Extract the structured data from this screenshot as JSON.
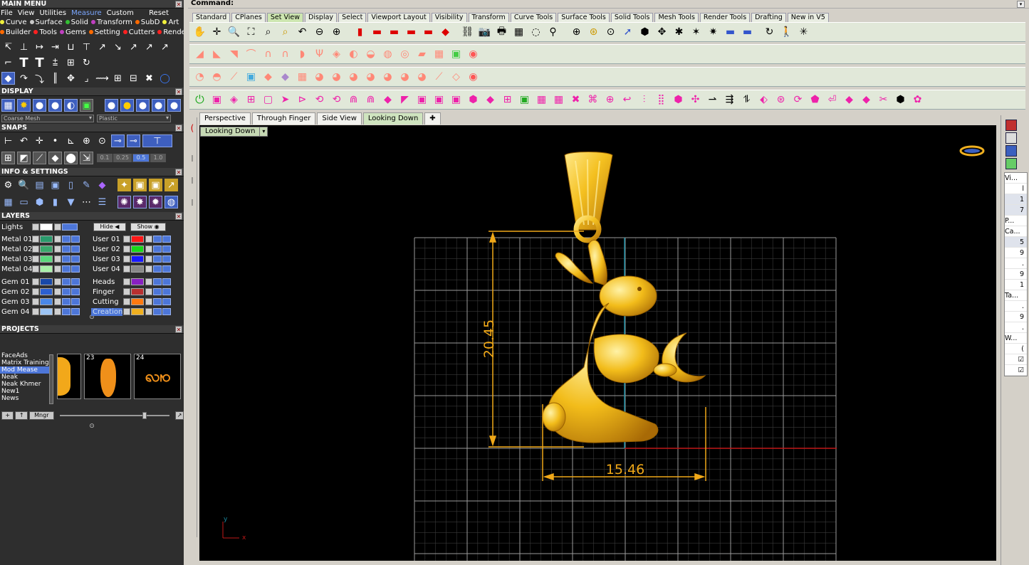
{
  "left": {
    "main_menu": {
      "title": "MAIN MENU",
      "menu": [
        "File",
        "View",
        "Utilities",
        "Measure",
        "Custom"
      ],
      "reset": "Reset",
      "row2": [
        {
          "label": "Curve",
          "color": "#f0f03c"
        },
        {
          "label": "Surface",
          "color": "#c8c8c8"
        },
        {
          "label": "Solid",
          "color": "#34c034"
        },
        {
          "label": "Transform",
          "color": "#c040c0"
        },
        {
          "label": "SubD",
          "color": "#ff6a00"
        },
        {
          "label": "Art",
          "color": "#f0f03c"
        }
      ],
      "row3": [
        {
          "label": "Builder",
          "color": "#ff6a00"
        },
        {
          "label": "Tools",
          "color": "#ff2020"
        },
        {
          "label": "Gems",
          "color": "#c040c0"
        },
        {
          "label": "Setting",
          "color": "#ff6a00"
        },
        {
          "label": "Cutters",
          "color": "#ff2020"
        },
        {
          "label": "Render",
          "color": "#ff2020"
        }
      ]
    },
    "display": {
      "title": "DISPLAY",
      "mesh_dropdown": "Coarse Mesh",
      "material_dropdown": "Plastic"
    },
    "snaps": {
      "title": "SNAPS",
      "values": [
        "0.1",
        "0.25",
        "0.5",
        "1.0"
      ]
    },
    "info": {
      "title": "INFO & SETTINGS"
    },
    "layers": {
      "title": "LAYERS",
      "lights": "Lights",
      "hide": "Hide",
      "show": "Show",
      "left_rows": [
        {
          "name": "Metal 01",
          "color": "#2a9a6c"
        },
        {
          "name": "Metal 02",
          "color": "#3aa86c"
        },
        {
          "name": "Metal 03",
          "color": "#5ad87c"
        },
        {
          "name": "Metal 04",
          "color": "#a8f0a8"
        },
        {
          "name": "Gem 01",
          "color": "#1848a8"
        },
        {
          "name": "Gem 02",
          "color": "#2c60d0"
        },
        {
          "name": "Gem 03",
          "color": "#4a88e8"
        },
        {
          "name": "Gem 04",
          "color": "#9cc4f4"
        }
      ],
      "right_rows": [
        {
          "name": "User 01",
          "color": "#ff1818"
        },
        {
          "name": "User 02",
          "color": "#18d818"
        },
        {
          "name": "User 03",
          "color": "#1818ff"
        },
        {
          "name": "User 04",
          "color": "#888888"
        },
        {
          "name": "Heads",
          "color": "#8820c0"
        },
        {
          "name": "Finger",
          "color": "#b83030"
        },
        {
          "name": "Cutting",
          "color": "#ff7a10"
        },
        {
          "name": "Creation",
          "color": "#f0b020"
        }
      ]
    },
    "projects": {
      "title": "PROJECTS",
      "items": [
        "FaceAds",
        "Matrix Training",
        "Mod Mease",
        "Neak",
        "Neak Khmer",
        "New1",
        "News"
      ],
      "selected": "Mod Mease",
      "thumb_numbers": [
        "23",
        "24"
      ],
      "mngr": "Mngr"
    }
  },
  "command": {
    "label": "Command:"
  },
  "tabs": [
    "Standard",
    "CPlanes",
    "Set View",
    "Display",
    "Select",
    "Viewport Layout",
    "Visibility",
    "Transform",
    "Curve Tools",
    "Surface Tools",
    "Solid Tools",
    "Mesh Tools",
    "Render Tools",
    "Drafting",
    "New in V5"
  ],
  "active_tab": "Set View",
  "viewport_tabs": [
    "Perspective",
    "Through Finger",
    "Side View",
    "Looking Down"
  ],
  "active_viewport_tab": "Looking Down",
  "viewport": {
    "label": "Looking Down",
    "dim_height": "20.45",
    "dim_width": "15.46",
    "axis_x": "x",
    "axis_y": "y"
  },
  "right_panel": {
    "items": [
      "Vi...",
      "l",
      "1",
      "7",
      "P...",
      "Ca...",
      "5",
      "9",
      ".",
      "9",
      "1",
      "Ta...",
      ".",
      "9",
      ".",
      "W...",
      "(",
      "☑",
      "☑"
    ]
  },
  "colors": {
    "gold": "#f2b40f",
    "dimension": "#f0a818",
    "grid": "#555555"
  }
}
